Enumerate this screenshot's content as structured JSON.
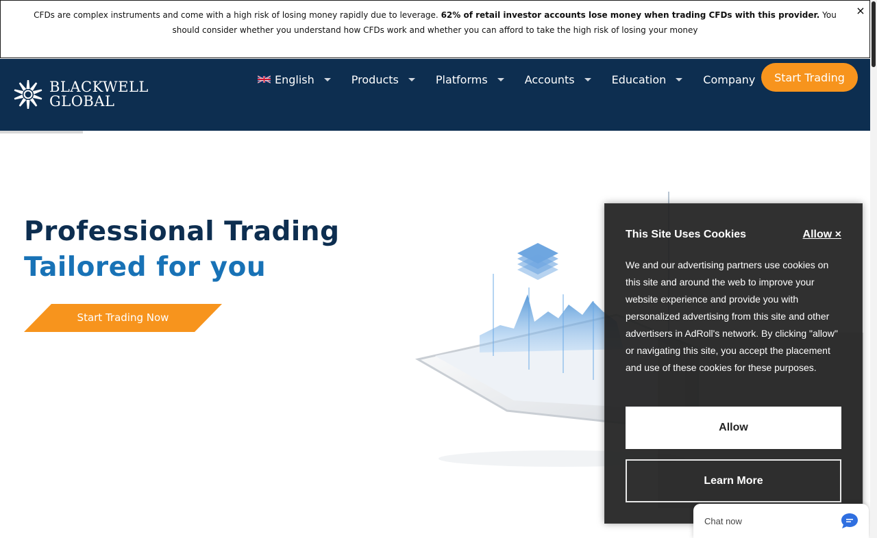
{
  "risk_banner": {
    "text_before": "CFDs are complex instruments and come with a high risk of losing money rapidly due to leverage.",
    "text_bold": "62% of retail investor accounts lose money when trading CFDs with this provider.",
    "text_after": "You should consider whether you understand how CFDs work and whether you can afford to take the high risk of losing your money",
    "close_label": "×"
  },
  "header": {
    "logo_line1": "BLACKWELL",
    "logo_line2": "GLOBAL",
    "nav": [
      {
        "label": "English",
        "icon": "uk-flag-icon"
      },
      {
        "label": "Products"
      },
      {
        "label": "Platforms"
      },
      {
        "label": "Accounts"
      },
      {
        "label": "Education"
      },
      {
        "label": "Company"
      }
    ],
    "cta_label": "Start Trading"
  },
  "hero": {
    "title_line1": "Professional Trading",
    "title_line2": "Tailored for you",
    "cta_label": "Start Trading Now"
  },
  "cookie_banner": {
    "title": "This Site Uses Cookies",
    "allow_link": "Allow ×",
    "body": "We and our advertising partners use cookies on this site and around the web to improve your website experience and provide you with personalized advertising from this site and other advertisers in AdRoll's network. By clicking \"allow\" or navigating this site, you accept the placement and use of these cookies for these purposes.",
    "allow_button": "Allow",
    "learn_more_button": "Learn More"
  },
  "chat": {
    "label": "Chat now",
    "icon": "chat-bubble-icon"
  },
  "colors": {
    "navy": "#0d2e50",
    "blue": "#1872b6",
    "orange": "#f7941d"
  }
}
